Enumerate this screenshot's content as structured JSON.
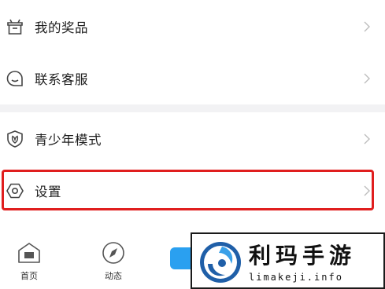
{
  "menu": {
    "group1": [
      {
        "label": "我的奖品",
        "icon": "gift-box-icon"
      },
      {
        "label": "联系客服",
        "icon": "customer-service-icon"
      }
    ],
    "group2": [
      {
        "label": "青少年模式",
        "icon": "shield-leaf-icon"
      },
      {
        "label": "设置",
        "icon": "hexagon-settings-icon"
      }
    ]
  },
  "tabbar": {
    "home_label": "首页",
    "dynamic_label": "动态"
  },
  "watermark": {
    "title": "利玛手游",
    "url": "limakeji.info"
  },
  "colors": {
    "highlight": "#e01e1e",
    "accent": "#2aa0f0"
  }
}
